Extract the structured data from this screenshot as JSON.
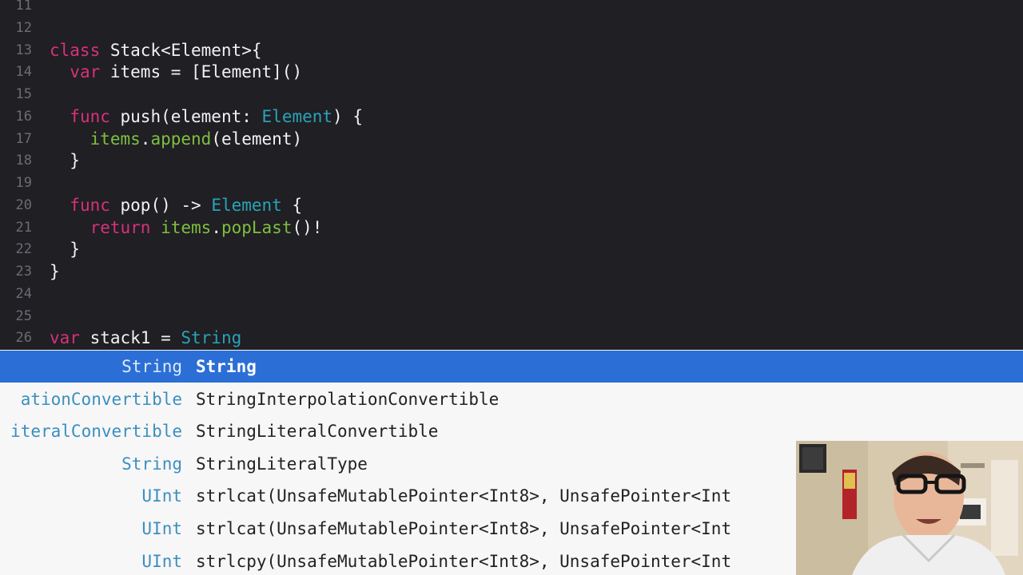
{
  "editor": {
    "lines": [
      {
        "num": "11",
        "tokens": []
      },
      {
        "num": "12",
        "tokens": []
      },
      {
        "num": "13",
        "tokens": [
          {
            "t": "class",
            "c": "kw"
          },
          {
            "t": " Stack<Element>{",
            "c": "pl"
          }
        ]
      },
      {
        "num": "14",
        "tokens": [
          {
            "t": "  ",
            "c": "pl"
          },
          {
            "t": "var",
            "c": "kw"
          },
          {
            "t": " items = [Element]()",
            "c": "pl"
          }
        ]
      },
      {
        "num": "15",
        "tokens": []
      },
      {
        "num": "16",
        "tokens": [
          {
            "t": "  ",
            "c": "pl"
          },
          {
            "t": "func",
            "c": "kw"
          },
          {
            "t": " push(element: ",
            "c": "pl"
          },
          {
            "t": "Element",
            "c": "ty"
          },
          {
            "t": ") {",
            "c": "pl"
          }
        ]
      },
      {
        "num": "17",
        "tokens": [
          {
            "t": "    ",
            "c": "pl"
          },
          {
            "t": "items",
            "c": "fn"
          },
          {
            "t": ".",
            "c": "pl"
          },
          {
            "t": "append",
            "c": "fn"
          },
          {
            "t": "(element)",
            "c": "pl"
          }
        ]
      },
      {
        "num": "18",
        "tokens": [
          {
            "t": "  }",
            "c": "pl"
          }
        ]
      },
      {
        "num": "19",
        "tokens": []
      },
      {
        "num": "20",
        "tokens": [
          {
            "t": "  ",
            "c": "pl"
          },
          {
            "t": "func",
            "c": "kw"
          },
          {
            "t": " pop() -> ",
            "c": "pl"
          },
          {
            "t": "Element",
            "c": "ty"
          },
          {
            "t": " {",
            "c": "pl"
          }
        ]
      },
      {
        "num": "21",
        "tokens": [
          {
            "t": "    ",
            "c": "pl"
          },
          {
            "t": "return",
            "c": "kw"
          },
          {
            "t": " ",
            "c": "pl"
          },
          {
            "t": "items",
            "c": "fn"
          },
          {
            "t": ".",
            "c": "pl"
          },
          {
            "t": "popLast",
            "c": "fn"
          },
          {
            "t": "()!",
            "c": "pl"
          }
        ]
      },
      {
        "num": "22",
        "tokens": [
          {
            "t": "  }",
            "c": "pl"
          }
        ]
      },
      {
        "num": "23",
        "tokens": [
          {
            "t": "}",
            "c": "pl"
          }
        ]
      },
      {
        "num": "24",
        "tokens": []
      },
      {
        "num": "25",
        "tokens": []
      },
      {
        "num": "26",
        "tokens": [
          {
            "t": "var",
            "c": "kw"
          },
          {
            "t": " stack1 = ",
            "c": "pl"
          },
          {
            "t": "String",
            "c": "ty"
          }
        ]
      }
    ]
  },
  "autocomplete": {
    "items": [
      {
        "type": "String",
        "suggestion": "String",
        "selected": true
      },
      {
        "type": "ationConvertible",
        "suggestion": "StringInterpolationConvertible",
        "selected": false
      },
      {
        "type": "iteralConvertible",
        "suggestion": "StringLiteralConvertible",
        "selected": false
      },
      {
        "type": "String",
        "suggestion": "StringLiteralType",
        "selected": false
      },
      {
        "type": "UInt",
        "suggestion": "strlcat(UnsafeMutablePointer<Int8>, UnsafePointer<Int",
        "selected": false
      },
      {
        "type": "UInt",
        "suggestion": "strlcat(UnsafeMutablePointer<Int8>, UnsafePointer<Int",
        "selected": false
      },
      {
        "type": "UInt",
        "suggestion": "strlcpy(UnsafeMutablePointer<Int8>, UnsafePointer<Int",
        "selected": false
      }
    ]
  },
  "colors": {
    "editor_bg": "#1f1f24",
    "keyword": "#d8317a",
    "type": "#2aa3b8",
    "function": "#7fbf3f",
    "selection": "#2b6fd6"
  }
}
